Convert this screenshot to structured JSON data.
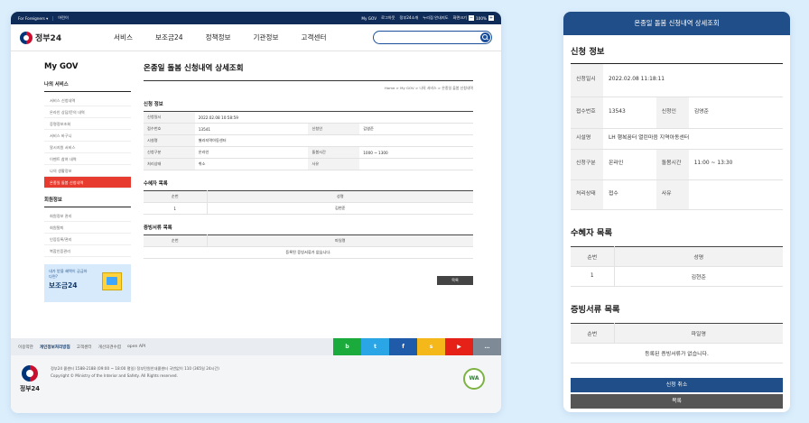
{
  "desktop": {
    "topbar": {
      "foreign": "For Foreigners ▾",
      "lang": "어린이",
      "links": [
        "My GOV",
        "로그아웃",
        "정부24소개",
        "누리집 안내지도",
        "화면크기"
      ],
      "zoom": "100%",
      "zoom_minus": "−",
      "zoom_plus": "+"
    },
    "logo_text": "정부24",
    "menu": [
      "서비스",
      "보조금24",
      "정책정보",
      "기관정보",
      "고객센터"
    ],
    "lnb": {
      "title": "My GOV",
      "group1": "나의 서비스",
      "items1": [
        "서비스 신청내역",
        "온라인 상담/문의 내역",
        "증명정보조회",
        "서비스 바구니",
        "알시지원 서비스",
        "이벤트 참여 내역",
        "나의 생활정보",
        "온종일 돌봄 신청내역"
      ],
      "group2": "회원정보",
      "items2": [
        "회원정보 관리",
        "회원탈퇴",
        "인증등록/관리",
        "복합인증관리"
      ]
    },
    "banner": {
      "line1": "내가 받을 혜택이 궁금하다면?",
      "line2": "보조금24"
    },
    "main": {
      "title": "온종일 돌봄 신청내역 상세조회",
      "breadcrumb": "Home  >  My GOV  >  나의 서비스  >  온종일 돌봄 신청내역",
      "section1": "신청 정보",
      "rows": [
        {
          "k1": "신청일시",
          "v1": "2022.02.08 10:58:59",
          "k2": "",
          "v2": ""
        },
        {
          "k1": "접수번호",
          "v1": "13541",
          "k2": "신청인",
          "v2": "김영준"
        },
        {
          "k1": "시설명",
          "v1": "별라지역아동센터",
          "k2": "",
          "v2": ""
        },
        {
          "k1": "신청구분",
          "v1": "온라인",
          "k2": "돌봄시간",
          "v2": "1000 ~ 1300"
        },
        {
          "k1": "처리상태",
          "v1": "취소",
          "k2": "사유",
          "v2": ""
        }
      ],
      "section2": "수혜자 목록",
      "list_headers": [
        "순번",
        "성명"
      ],
      "beneficiaries": [
        {
          "no": "1",
          "name": "김현준"
        }
      ],
      "section3": "증빙서류 목록",
      "doc_headers": [
        "순번",
        "파일명"
      ],
      "doc_empty": "등록된 증빙서류가 없습니다.",
      "list_button": "목록"
    },
    "footer": {
      "links": [
        "이용약관",
        "개인정보처리방침",
        "고객센터",
        "개선의견수렴",
        "open API"
      ],
      "sns": [
        "b",
        "t",
        "f",
        "s",
        "▶",
        "…"
      ],
      "sns_colors": [
        "#1aab3c",
        "#2aa5e5",
        "#1f5ba8",
        "#f5b81b",
        "#e62117",
        "#7e8a96"
      ],
      "logo_text": "정부24",
      "line1": "정부24 콜센터 1588-2188 (09:00 ~ 18:00 평일) 정부민원안내콜센터 국번없이 110 (365일 24시간)",
      "line2": "Copyright © Ministry of the Interior and Safety. All Rights reserved.",
      "wa": "WA"
    }
  },
  "mobile": {
    "header": "온종일 돌봄 신청내역 상세조회",
    "section1": "신청 정보",
    "rows": {
      "date_k": "신청일시",
      "date_v": "2022.02.08 11:18:11",
      "no_k": "접수번호",
      "no_v": "13543",
      "applicant_k": "신청인",
      "applicant_v": "김영준",
      "facility_k": "시설명",
      "facility_v": "LH 행복꿈터 열린마음 지역아동센터",
      "type_k": "신청구분",
      "type_v": "온라인",
      "time_k": "돌봄시간",
      "time_v": "11:00 ~ 13:30",
      "status_k": "처리상태",
      "status_v": "접수",
      "reason_k": "사유",
      "reason_v": ""
    },
    "section2": "수혜자 목록",
    "list_headers": [
      "순번",
      "성명"
    ],
    "beneficiaries": [
      {
        "no": "1",
        "name": "김현준"
      }
    ],
    "section3": "증빙서류 목록",
    "doc_headers": [
      "순번",
      "파일명"
    ],
    "doc_empty": "등록된 증빙서류가 없습니다.",
    "cancel_button": "신청 취소",
    "list_button": "목록"
  }
}
